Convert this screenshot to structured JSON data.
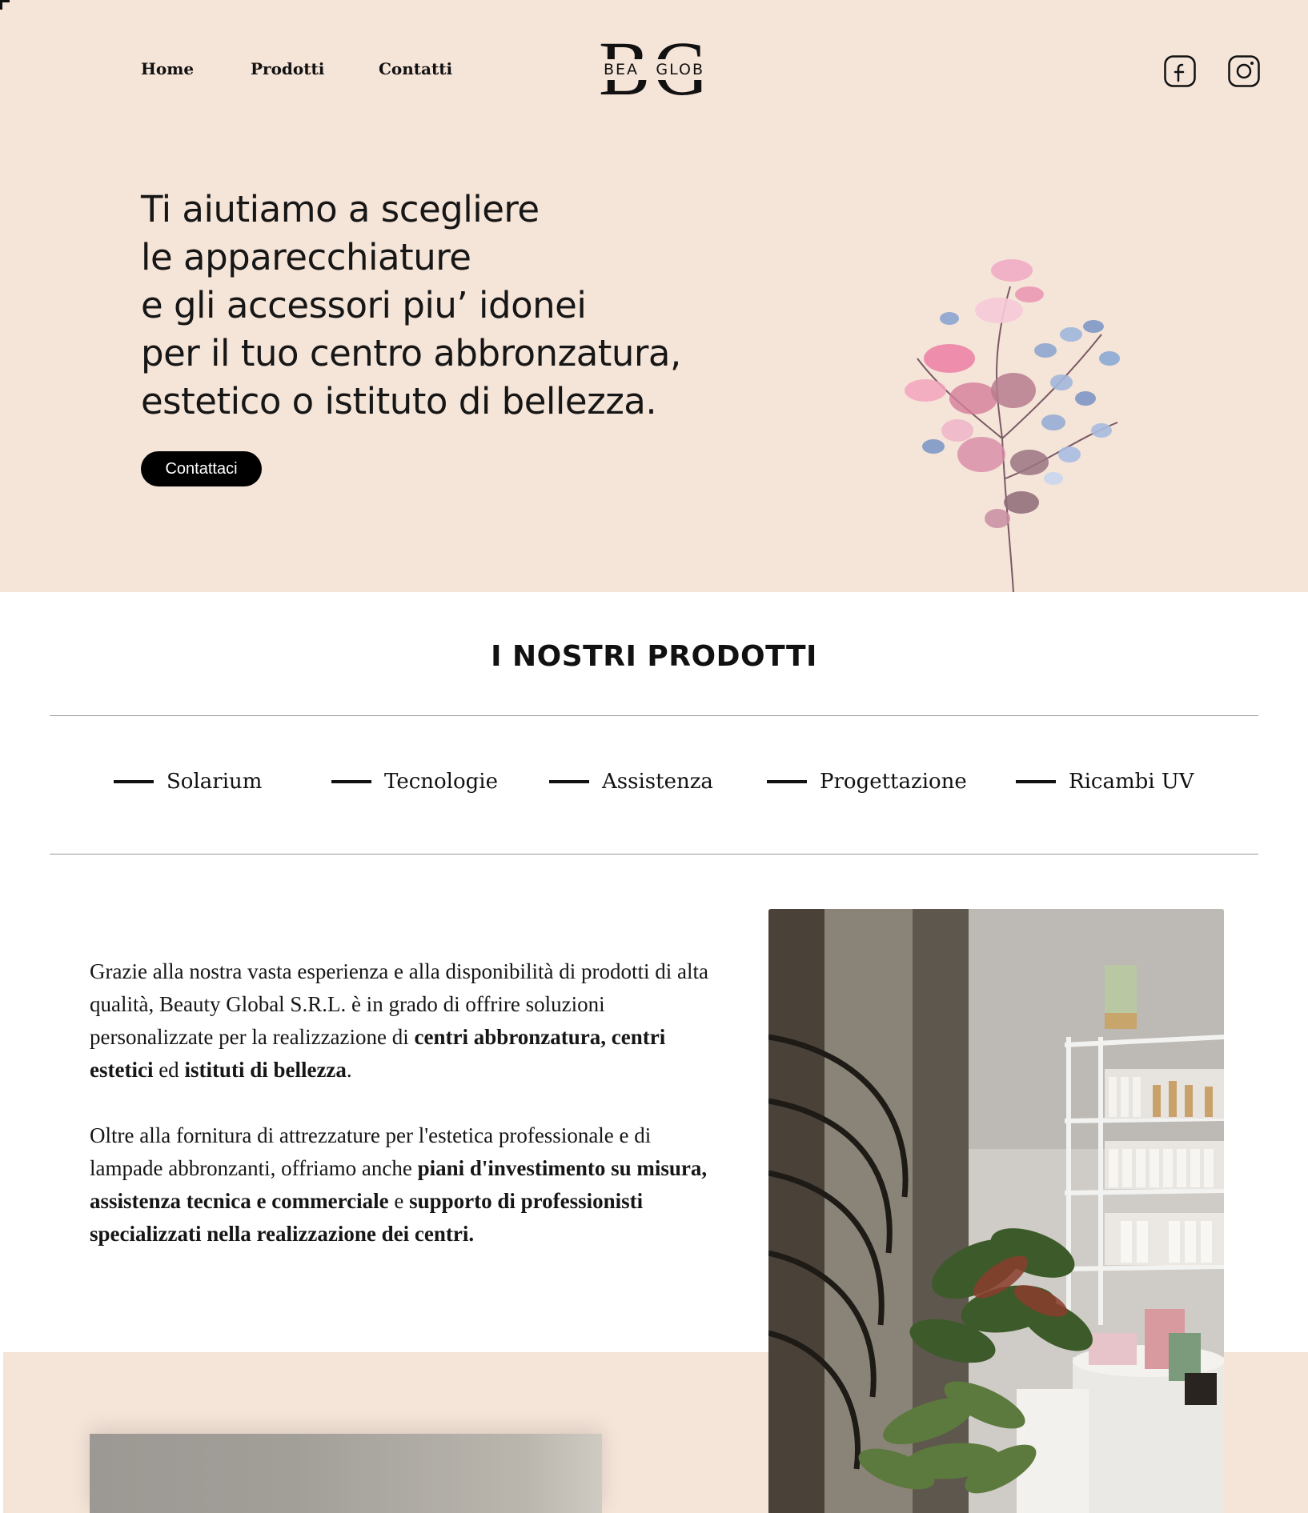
{
  "nav": {
    "home": "Home",
    "products": "Prodotti",
    "contacts": "Contatti"
  },
  "logo": {
    "letters_left": "B",
    "letters_right": "G",
    "word_left": "BEA",
    "word_right": "GLOB"
  },
  "social": {
    "facebook_icon": "facebook-icon",
    "instagram_icon": "instagram-icon"
  },
  "hero": {
    "lines": [
      "Ti aiutiamo a scegliere",
      "le apparecchiature",
      "e gli accessori piu’ idonei",
      "per il tuo centro abbronzatura,",
      "estetico o istituto di bellezza."
    ],
    "cta": "Contattaci"
  },
  "products": {
    "title": "I NOSTRI PRODOTTI",
    "categories": [
      "Solarium",
      "Tecnologie",
      "Assistenza",
      "Progettazione",
      "Ricambi UV"
    ]
  },
  "about": {
    "p1": [
      {
        "text": "Grazie alla nostra vasta esperienza e alla disponibilità di prodotti di alta qualità, Beauty Global S.R.L. è in grado di offrire soluzioni personalizzate per la realizzazione di ",
        "bold": false
      },
      {
        "text": "centri abbronzatura, centri estetici",
        "bold": true
      },
      {
        "text": " ed ",
        "bold": false
      },
      {
        "text": "istituti di bellezza",
        "bold": true
      },
      {
        "text": ".",
        "bold": false
      }
    ],
    "p2": [
      {
        "text": "Oltre alla fornitura di attrezzature per l'estetica professionale e di lampade abbronzanti, offriamo anche ",
        "bold": false
      },
      {
        "text": "piani d'investimento su misura, assistenza tecnica e commerciale",
        "bold": true
      },
      {
        "text": " e ",
        "bold": false
      },
      {
        "text": "supporto di professionisti specializzati nella realizzazione dei centri.",
        "bold": true
      }
    ]
  },
  "colors": {
    "hero_bg": "#f5e4d8",
    "text": "#111111",
    "cta_bg": "#000000",
    "cta_text": "#ffffff"
  }
}
